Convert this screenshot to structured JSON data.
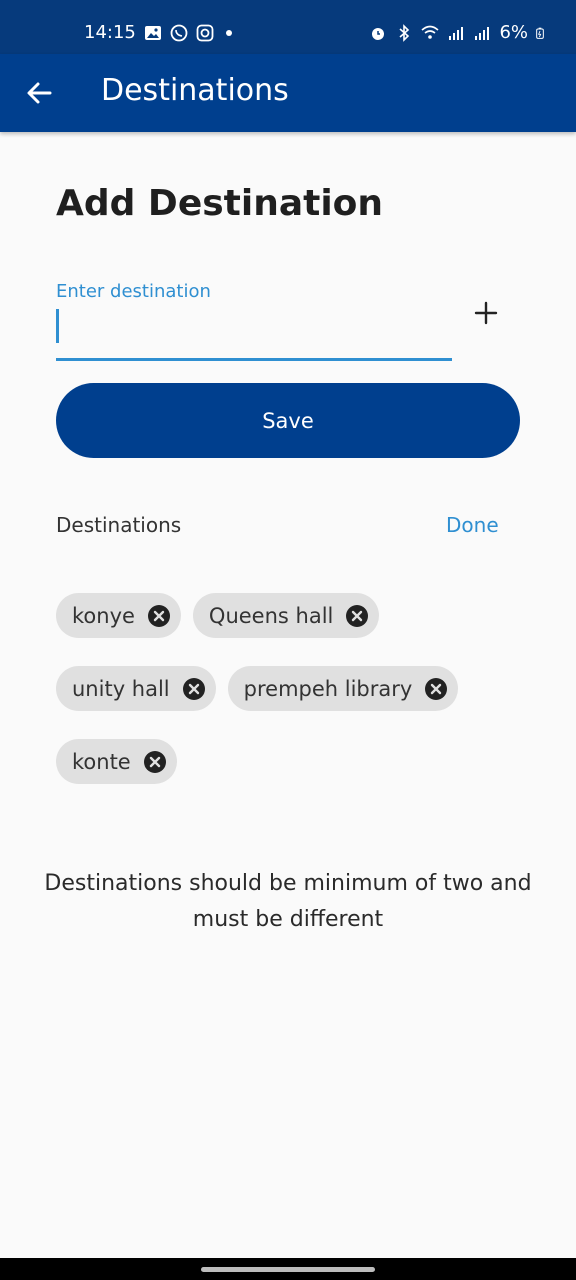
{
  "status_bar": {
    "time": "14:15",
    "battery": "6%",
    "left_icons": [
      "gallery-icon",
      "whatsapp-icon",
      "instagram-icon",
      "notification-dot-icon"
    ],
    "right_icons": [
      "alarm-icon",
      "bluetooth-icon",
      "wifi-icon",
      "signal-icon",
      "signal-icon",
      "battery-icon"
    ]
  },
  "app_bar": {
    "title": "Destinations",
    "back_icon": "arrow-left-icon",
    "color": "#003f8e"
  },
  "form": {
    "heading": "Add Destination",
    "input_label": "Enter destination",
    "input_value": "",
    "add_icon": "plus-icon",
    "save_label": "Save",
    "accent_color": "#2f8fd1"
  },
  "destinations": {
    "section_label": "Destinations",
    "done_label": "Done",
    "chips": [
      {
        "label": "konye"
      },
      {
        "label": "Queens hall"
      },
      {
        "label": "unity hall"
      },
      {
        "label": "prempeh library"
      },
      {
        "label": "konte"
      }
    ]
  },
  "note": "Destinations should be minimum of two and must be different"
}
